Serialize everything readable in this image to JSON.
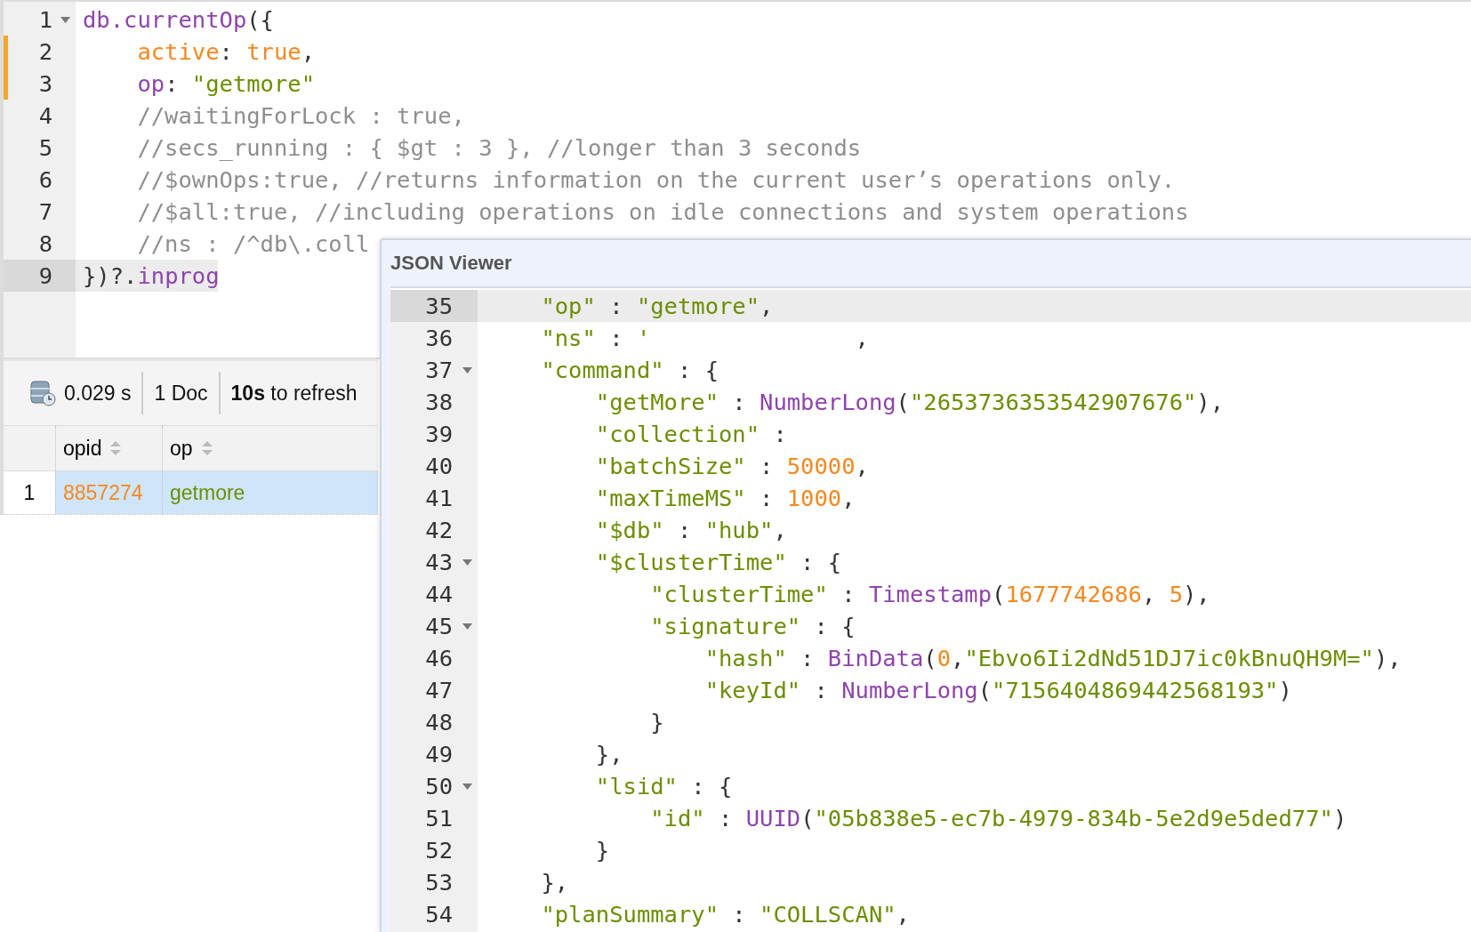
{
  "editor": {
    "lines": [
      {
        "number": "1",
        "foldable": true,
        "changed": false,
        "active": false,
        "tokens": [
          {
            "kind": "prop",
            "t": "db.currentOp"
          },
          {
            "kind": "plain",
            "t": "({"
          }
        ]
      },
      {
        "number": "2",
        "foldable": false,
        "changed": true,
        "active": false,
        "tokens": [
          {
            "kind": "atom",
            "t": "    active"
          },
          {
            "kind": "plain",
            "t": ": "
          },
          {
            "kind": "atom",
            "t": "true"
          },
          {
            "kind": "plain",
            "t": ","
          }
        ]
      },
      {
        "number": "3",
        "foldable": false,
        "changed": true,
        "active": false,
        "tokens": [
          {
            "kind": "prop",
            "t": "    op"
          },
          {
            "kind": "plain",
            "t": ": "
          },
          {
            "kind": "string",
            "t": "\"getmore\""
          }
        ]
      },
      {
        "number": "4",
        "foldable": false,
        "changed": false,
        "active": false,
        "tokens": [
          {
            "kind": "comment",
            "t": "    //waitingForLock : true,"
          }
        ]
      },
      {
        "number": "5",
        "foldable": false,
        "changed": false,
        "active": false,
        "tokens": [
          {
            "kind": "comment",
            "t": "    //secs_running : { $gt : 3 }, //longer than 3 seconds"
          }
        ]
      },
      {
        "number": "6",
        "foldable": false,
        "changed": false,
        "active": false,
        "tokens": [
          {
            "kind": "comment",
            "t": "    //$ownOps:true, //returns information on the current user’s operations only."
          }
        ]
      },
      {
        "number": "7",
        "foldable": false,
        "changed": false,
        "active": false,
        "tokens": [
          {
            "kind": "comment",
            "t": "    //$all:true, //including operations on idle connections and system operations"
          }
        ]
      },
      {
        "number": "8",
        "foldable": false,
        "changed": false,
        "active": false,
        "tokens": [
          {
            "kind": "comment",
            "t": "    //ns : /^db\\.coll"
          }
        ]
      },
      {
        "number": "9",
        "foldable": false,
        "changed": false,
        "active": true,
        "tokens": [
          {
            "kind": "plain",
            "t": "})?."
          },
          {
            "kind": "prop",
            "t": "inprog"
          }
        ]
      }
    ]
  },
  "results": {
    "toolbar": {
      "time": "0.029 s",
      "count": "1 Doc",
      "refresh": "**10s** to refresh"
    },
    "columns": [
      {
        "label": "opid"
      },
      {
        "label": "op"
      }
    ],
    "rows": [
      {
        "number": "1",
        "selected": true,
        "cells": [
          {
            "text": "8857274",
            "kind": "number"
          },
          {
            "text": "getmore",
            "kind": "string"
          }
        ]
      }
    ]
  },
  "json_viewer": {
    "title": "JSON Viewer",
    "lines": [
      {
        "number": "35",
        "foldable": false,
        "active": true,
        "tokens": [
          {
            "kind": "string",
            "t": "    \"op\""
          },
          {
            "kind": "plain",
            "t": " : "
          },
          {
            "kind": "string",
            "t": "\"getmore\""
          },
          {
            "kind": "plain",
            "t": ","
          }
        ]
      },
      {
        "number": "36",
        "foldable": false,
        "active": false,
        "tokens": [
          {
            "kind": "string",
            "t": "    \"ns\""
          },
          {
            "kind": "plain",
            "t": " : "
          },
          {
            "kind": "string",
            "t": "'"
          },
          {
            "kind": "plain",
            "t": "               ,"
          }
        ]
      },
      {
        "number": "37",
        "foldable": true,
        "active": false,
        "tokens": [
          {
            "kind": "string",
            "t": "    \"command\""
          },
          {
            "kind": "plain",
            "t": " : {"
          }
        ]
      },
      {
        "number": "38",
        "foldable": false,
        "active": false,
        "tokens": [
          {
            "kind": "string",
            "t": "        \"getMore\""
          },
          {
            "kind": "plain",
            "t": " : "
          },
          {
            "kind": "prop",
            "t": "NumberLong"
          },
          {
            "kind": "plain",
            "t": "("
          },
          {
            "kind": "string",
            "t": "\"2653736353542907676\""
          },
          {
            "kind": "plain",
            "t": "),"
          }
        ]
      },
      {
        "number": "39",
        "foldable": false,
        "active": false,
        "tokens": [
          {
            "kind": "string",
            "t": "        \"collection\""
          },
          {
            "kind": "plain",
            "t": " :"
          }
        ]
      },
      {
        "number": "40",
        "foldable": false,
        "active": false,
        "tokens": [
          {
            "kind": "string",
            "t": "        \"batchSize\""
          },
          {
            "kind": "plain",
            "t": " : "
          },
          {
            "kind": "atom",
            "t": "50000"
          },
          {
            "kind": "plain",
            "t": ","
          }
        ]
      },
      {
        "number": "41",
        "foldable": false,
        "active": false,
        "tokens": [
          {
            "kind": "string",
            "t": "        \"maxTimeMS\""
          },
          {
            "kind": "plain",
            "t": " : "
          },
          {
            "kind": "atom",
            "t": "1000"
          },
          {
            "kind": "plain",
            "t": ","
          }
        ]
      },
      {
        "number": "42",
        "foldable": false,
        "active": false,
        "tokens": [
          {
            "kind": "string",
            "t": "        \"$db\""
          },
          {
            "kind": "plain",
            "t": " : "
          },
          {
            "kind": "string",
            "t": "\"hub\""
          },
          {
            "kind": "plain",
            "t": ","
          }
        ]
      },
      {
        "number": "43",
        "foldable": true,
        "active": false,
        "tokens": [
          {
            "kind": "string",
            "t": "        \"$clusterTime\""
          },
          {
            "kind": "plain",
            "t": " : {"
          }
        ]
      },
      {
        "number": "44",
        "foldable": false,
        "active": false,
        "tokens": [
          {
            "kind": "string",
            "t": "            \"clusterTime\""
          },
          {
            "kind": "plain",
            "t": " : "
          },
          {
            "kind": "prop",
            "t": "Timestamp"
          },
          {
            "kind": "plain",
            "t": "("
          },
          {
            "kind": "atom",
            "t": "1677742686"
          },
          {
            "kind": "plain",
            "t": ", "
          },
          {
            "kind": "atom",
            "t": "5"
          },
          {
            "kind": "plain",
            "t": "),"
          }
        ]
      },
      {
        "number": "45",
        "foldable": true,
        "active": false,
        "tokens": [
          {
            "kind": "string",
            "t": "            \"signature\""
          },
          {
            "kind": "plain",
            "t": " : {"
          }
        ]
      },
      {
        "number": "46",
        "foldable": false,
        "active": false,
        "tokens": [
          {
            "kind": "string",
            "t": "                \"hash\""
          },
          {
            "kind": "plain",
            "t": " : "
          },
          {
            "kind": "prop",
            "t": "BinData"
          },
          {
            "kind": "plain",
            "t": "("
          },
          {
            "kind": "atom",
            "t": "0"
          },
          {
            "kind": "plain",
            "t": ","
          },
          {
            "kind": "string",
            "t": "\"Ebvo6Ii2dNd51DJ7ic0kBnuQH9M=\""
          },
          {
            "kind": "plain",
            "t": "),"
          }
        ]
      },
      {
        "number": "47",
        "foldable": false,
        "active": false,
        "tokens": [
          {
            "kind": "string",
            "t": "                \"keyId\""
          },
          {
            "kind": "plain",
            "t": " : "
          },
          {
            "kind": "prop",
            "t": "NumberLong"
          },
          {
            "kind": "plain",
            "t": "("
          },
          {
            "kind": "string",
            "t": "\"7156404869442568193\""
          },
          {
            "kind": "plain",
            "t": ")"
          }
        ]
      },
      {
        "number": "48",
        "foldable": false,
        "active": false,
        "tokens": [
          {
            "kind": "plain",
            "t": "            }"
          }
        ]
      },
      {
        "number": "49",
        "foldable": false,
        "active": false,
        "tokens": [
          {
            "kind": "plain",
            "t": "        },"
          }
        ]
      },
      {
        "number": "50",
        "foldable": true,
        "active": false,
        "tokens": [
          {
            "kind": "string",
            "t": "        \"lsid\""
          },
          {
            "kind": "plain",
            "t": " : {"
          }
        ]
      },
      {
        "number": "51",
        "foldable": false,
        "active": false,
        "tokens": [
          {
            "kind": "string",
            "t": "            \"id\""
          },
          {
            "kind": "plain",
            "t": " : "
          },
          {
            "kind": "prop",
            "t": "UUID"
          },
          {
            "kind": "plain",
            "t": "("
          },
          {
            "kind": "string",
            "t": "\"05b838e5-ec7b-4979-834b-5e2d9e5ded77\""
          },
          {
            "kind": "plain",
            "t": ")"
          }
        ]
      },
      {
        "number": "52",
        "foldable": false,
        "active": false,
        "tokens": [
          {
            "kind": "plain",
            "t": "        }"
          }
        ]
      },
      {
        "number": "53",
        "foldable": false,
        "active": false,
        "tokens": [
          {
            "kind": "plain",
            "t": "    },"
          }
        ]
      },
      {
        "number": "54",
        "foldable": false,
        "active": false,
        "tokens": [
          {
            "kind": "string",
            "t": "    \"planSummary\""
          },
          {
            "kind": "plain",
            "t": " : "
          },
          {
            "kind": "string",
            "t": "\"COLLSCAN\""
          },
          {
            "kind": "plain",
            "t": ","
          }
        ]
      }
    ]
  }
}
